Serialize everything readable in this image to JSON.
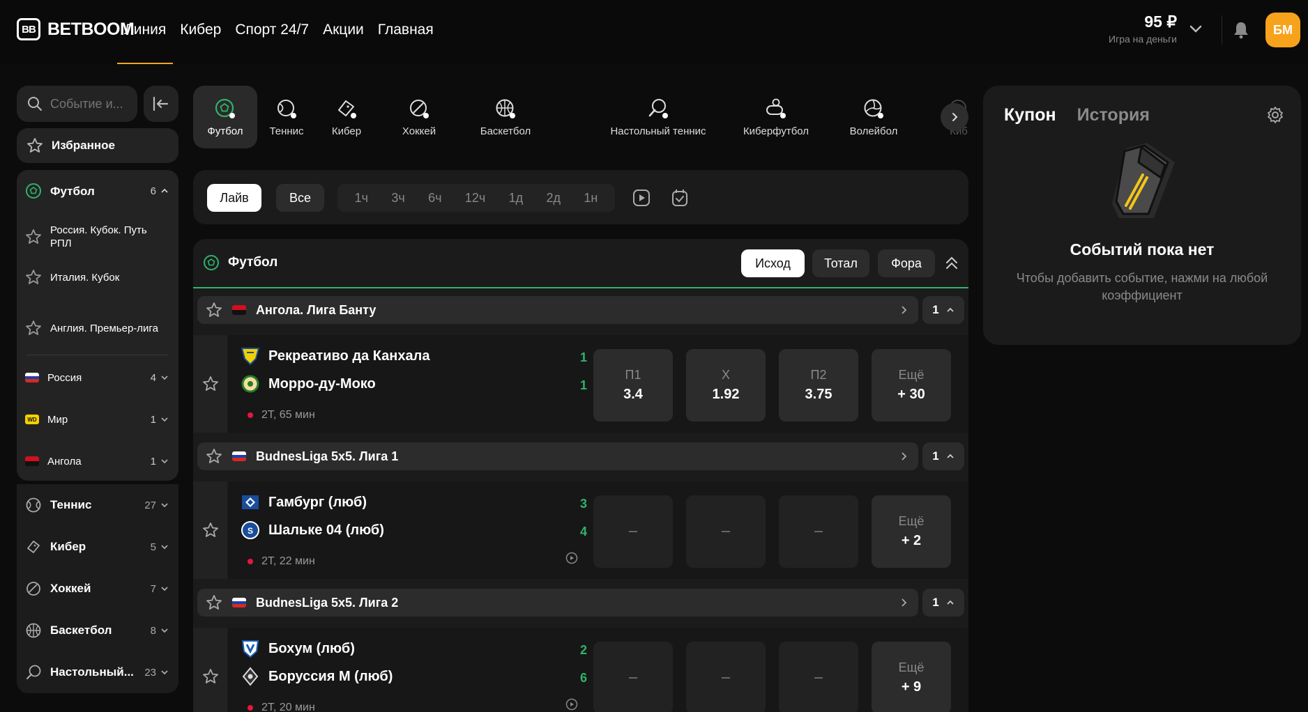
{
  "brand": {
    "logo_mark": "BB",
    "name": "BETBOOM"
  },
  "nav": [
    {
      "label": "Линия"
    },
    {
      "label": "Кибер"
    },
    {
      "label": "Спорт 24/7"
    },
    {
      "label": "Акции"
    },
    {
      "label": "Главная"
    }
  ],
  "account": {
    "balance": "95 ₽",
    "balance_caption": "Игра на деньги",
    "avatar_initials": "БМ"
  },
  "sidebar": {
    "search_placeholder": "Событие и...",
    "favorites_label": "Избранное",
    "expanded_sport": {
      "label": "Футбол",
      "count": "6"
    },
    "football_items": [
      {
        "label": "Россия. Кубок. Путь РПЛ"
      },
      {
        "label": "Италия. Кубок"
      },
      {
        "label": "Англия. Премьер-лига"
      }
    ],
    "countries": [
      {
        "label": "Россия",
        "count": "4",
        "flag": "ru"
      },
      {
        "label": "Мир",
        "count": "1",
        "flag": "wd",
        "flag_text": "WD"
      },
      {
        "label": "Ангола",
        "count": "1",
        "flag": "ao"
      }
    ],
    "sports": [
      {
        "label": "Теннис",
        "count": "27",
        "icon": "tennis-icon"
      },
      {
        "label": "Кибер",
        "count": "5",
        "icon": "gamepad-icon"
      },
      {
        "label": "Хоккей",
        "count": "7",
        "icon": "hockey-icon"
      },
      {
        "label": "Баскетбол",
        "count": "8",
        "icon": "basketball-icon"
      },
      {
        "label": "Настольный...",
        "count": "23",
        "icon": "table-tennis-icon"
      }
    ]
  },
  "sport_tabs": [
    {
      "label": "Футбол",
      "icon": "soccer-ball-icon",
      "active": true
    },
    {
      "label": "Теннис",
      "icon": "tennis-icon"
    },
    {
      "label": "Кибер",
      "icon": "gamepad-icon"
    },
    {
      "label": "Хоккей",
      "icon": "hockey-icon"
    },
    {
      "label": "Баскетбол",
      "icon": "basketball-icon"
    },
    {
      "label": "Настольный теннис",
      "icon": "table-tennis-icon"
    },
    {
      "label": "Киберфутбол",
      "icon": "cyber-football-icon"
    },
    {
      "label": "Волейбол",
      "icon": "volleyball-icon"
    },
    {
      "label": "Киб",
      "icon": "cyber-icon"
    }
  ],
  "filters": {
    "live": "Лайв",
    "all": "Все",
    "periods": [
      "1ч",
      "3ч",
      "6ч",
      "12ч",
      "1д",
      "2д",
      "1н"
    ]
  },
  "events": {
    "title": "Футбол",
    "markets": [
      "Исход",
      "Тотал",
      "Фора"
    ],
    "leagues": [
      {
        "name": "Ангола. Лига Банту",
        "flag": "ao",
        "count": "1",
        "match": {
          "home": "Рекреативо да Канхала",
          "away": "Морро-ду-Моко",
          "home_score": "1",
          "away_score": "1",
          "time": "2Т, 65 мин",
          "odds": [
            {
              "label": "П1",
              "value": "3.4"
            },
            {
              "label": "Х",
              "value": "1.92"
            },
            {
              "label": "П2",
              "value": "3.75"
            }
          ],
          "more": {
            "label": "Ещё",
            "value": "+ 30"
          }
        }
      },
      {
        "name": "BudnesLiga 5x5. Лига 1",
        "flag": "ru",
        "count": "1",
        "match": {
          "home": "Гамбург (люб)",
          "away": "Шальке 04 (люб)",
          "home_score": "3",
          "away_score": "4",
          "time": "2Т, 22 мин",
          "odds": [],
          "more": {
            "label": "Ещё",
            "value": "+ 2"
          }
        }
      },
      {
        "name": "BudnesLiga 5x5. Лига 2",
        "flag": "ru",
        "count": "1",
        "match": {
          "home": "Бохум (люб)",
          "away": "Боруссия М (люб)",
          "home_score": "2",
          "away_score": "6",
          "time": "2Т, 20 мин",
          "odds": [],
          "more": {
            "label": "Ещё",
            "value": "+ 9"
          }
        }
      }
    ]
  },
  "coupon": {
    "tabs": [
      "Купон",
      "История"
    ],
    "empty_title": "Событий пока нет",
    "empty_text": "Чтобы добавить событие, нажми на любой коэффициент"
  },
  "colors": {
    "accent": "#f7a21b",
    "live_green": "#2fb36b",
    "live_dot": "#e5173f",
    "panel": "#1b1b1b"
  }
}
